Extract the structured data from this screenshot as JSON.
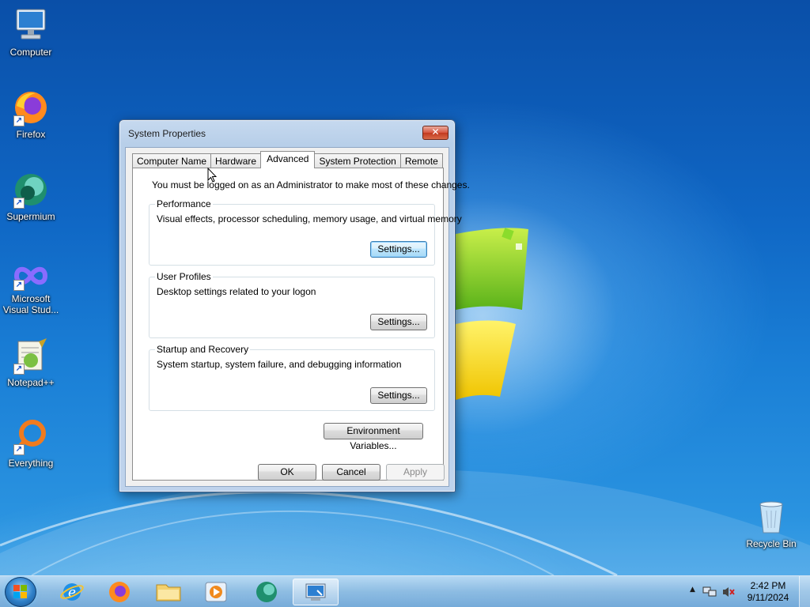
{
  "desktop": {
    "icons": [
      {
        "label": "Computer"
      },
      {
        "label": "Firefox"
      },
      {
        "label": "Supermium"
      },
      {
        "label": "Microsoft Visual Stud..."
      },
      {
        "label": "Notepad++"
      },
      {
        "label": "Everything"
      },
      {
        "label": "Recycle Bin"
      }
    ]
  },
  "dialog": {
    "title": "System Properties",
    "close_glyph": "✕",
    "tabs": [
      {
        "label": "Computer Name"
      },
      {
        "label": "Hardware"
      },
      {
        "label": "Advanced"
      },
      {
        "label": "System Protection"
      },
      {
        "label": "Remote"
      }
    ],
    "active_tab": "Advanced",
    "admin_note": "You must be logged on as an Administrator to make most of these changes.",
    "groups": {
      "performance": {
        "title": "Performance",
        "desc": "Visual effects, processor scheduling, memory usage, and virtual memory",
        "button": "Settings..."
      },
      "user_profiles": {
        "title": "User Profiles",
        "desc": "Desktop settings related to your logon",
        "button": "Settings..."
      },
      "startup_recovery": {
        "title": "Startup and Recovery",
        "desc": "System startup, system failure, and debugging information",
        "button": "Settings..."
      }
    },
    "env_button": "Environment Variables...",
    "ok": "OK",
    "cancel": "Cancel",
    "apply": "Apply"
  },
  "taskbar": {
    "items": [
      {
        "name": "internet-explorer-icon"
      },
      {
        "name": "firefox-icon"
      },
      {
        "name": "file-explorer-icon"
      },
      {
        "name": "media-player-icon"
      },
      {
        "name": "supermium-icon"
      },
      {
        "name": "system-properties-icon"
      }
    ],
    "tray_expand": "▲",
    "time": "2:42 PM",
    "date": "9/11/2024"
  },
  "colors": {
    "desktop_blue": "#0f66c4",
    "close_red": "#c2391f",
    "focus_blue": "#3c7fb1"
  }
}
